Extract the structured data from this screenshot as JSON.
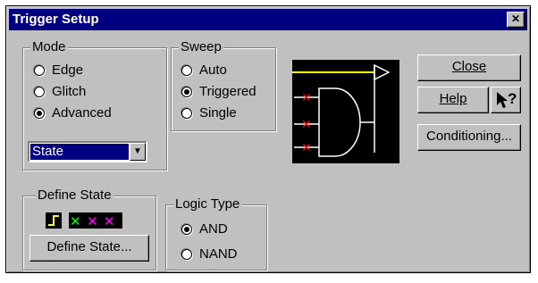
{
  "window": {
    "title": "Trigger Setup",
    "close_glyph": "✕"
  },
  "mode": {
    "legend": "Mode",
    "options": [
      "Edge",
      "Glitch",
      "Advanced"
    ],
    "selected": "Advanced",
    "dropdown_value": "State",
    "dropdown_arrow": "▼"
  },
  "sweep": {
    "legend": "Sweep",
    "options": [
      "Auto",
      "Triggered",
      "Single"
    ],
    "selected": "Triggered"
  },
  "define_state": {
    "legend": "Define State",
    "button_label": "Define State...",
    "icons": [
      "rising-edge-icon",
      "x-green-icon",
      "x-magenta-icon",
      "x-magenta-icon"
    ]
  },
  "logic_type": {
    "legend": "Logic Type",
    "options": [
      "AND",
      "NAND"
    ],
    "selected": "AND"
  },
  "buttons": {
    "close": "Close",
    "help": "Help",
    "context_help_glyph": "?",
    "conditioning": "Conditioning..."
  },
  "colors": {
    "title_bg": "#000080",
    "face": "#c0c0c0",
    "diagram_bg": "#000000",
    "x_red": "#ff0000",
    "gate_line": "#ffffff",
    "trigger_line": "#ffff00"
  }
}
